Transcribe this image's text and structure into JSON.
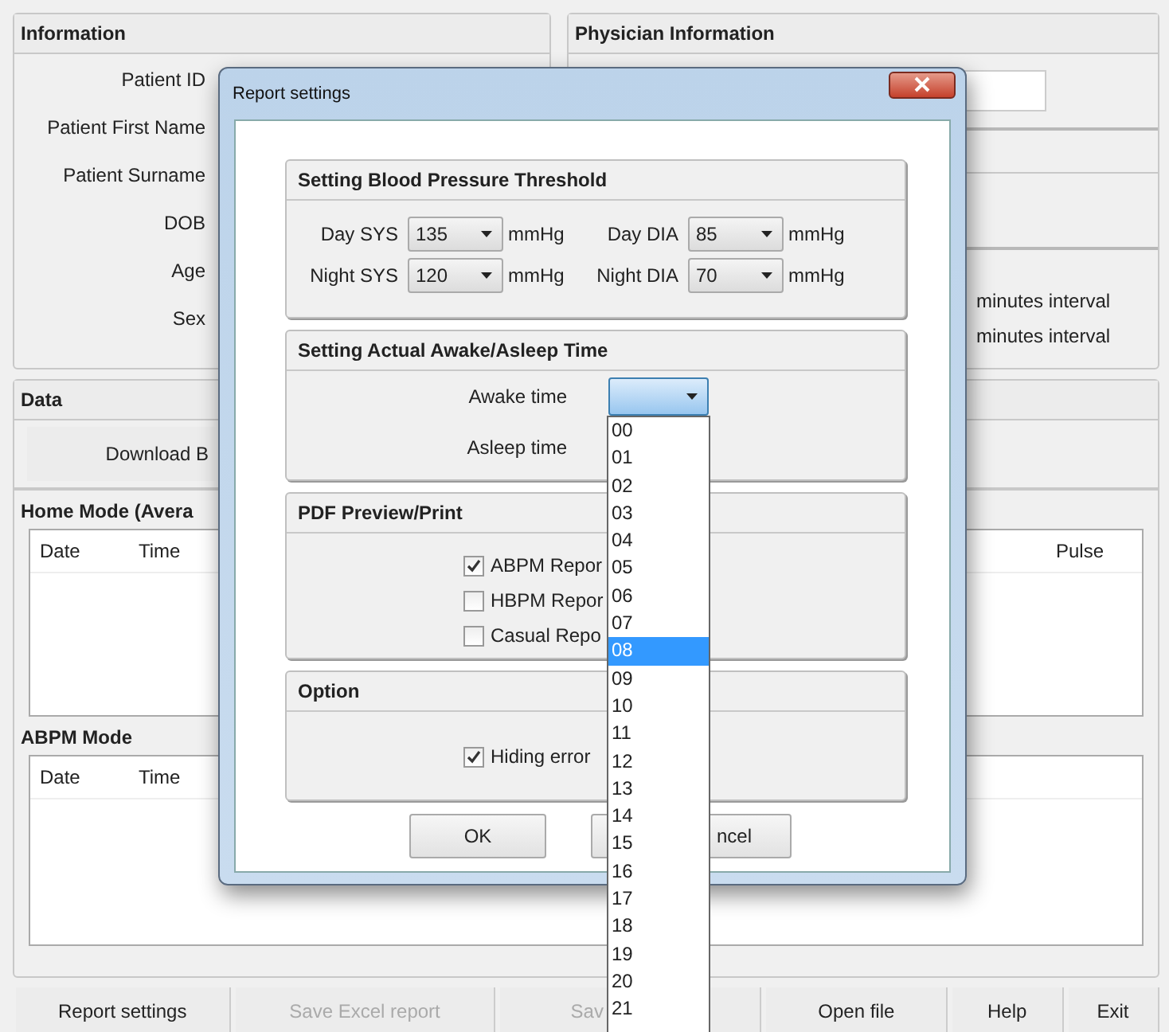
{
  "information": {
    "title": "Information",
    "fields": [
      "Patient ID",
      "Patient First Name",
      "Patient Surname",
      "DOB",
      "Age",
      "Sex"
    ]
  },
  "physician": {
    "title": "Physician Information",
    "intervals": [
      "minutes interval",
      "minutes interval"
    ]
  },
  "data": {
    "title": "Data",
    "download_button": "Download B",
    "home_mode": {
      "title": "Home Mode (Avera",
      "columns": [
        "Date",
        "Time"
      ],
      "right_column": "Pulse"
    },
    "abpm_mode": {
      "title": "ABPM Mode",
      "columns": [
        "Date",
        "Time"
      ]
    }
  },
  "bottom_buttons": [
    {
      "label": "Report settings",
      "disabled": false
    },
    {
      "label": "Save Excel report",
      "disabled": true
    },
    {
      "label": "Sav",
      "disabled": true
    },
    {
      "label": "Open file",
      "disabled": false
    },
    {
      "label": "Help",
      "disabled": false
    },
    {
      "label": "Exit",
      "disabled": false
    }
  ],
  "dialog": {
    "title": "Report settings",
    "threshold": {
      "title": "Setting Blood Pressure Threshold",
      "rows": [
        {
          "label": "Day SYS",
          "value": "135",
          "unit": "mmHg"
        },
        {
          "label": "Day DIA",
          "value": "85",
          "unit": "mmHg"
        },
        {
          "label": "Night SYS",
          "value": "120",
          "unit": "mmHg"
        },
        {
          "label": "Night DIA",
          "value": "70",
          "unit": "mmHg"
        }
      ]
    },
    "time": {
      "title": "Setting Actual Awake/Asleep Time",
      "awake_label": "Awake time",
      "asleep_label": "Asleep time"
    },
    "pdf": {
      "title": "PDF Preview/Print",
      "options": [
        {
          "label": "ABPM Repor",
          "checked": true
        },
        {
          "label": "HBPM Repor",
          "checked": false
        },
        {
          "label": "Casual Repo",
          "checked": false
        }
      ]
    },
    "option": {
      "title": "Option",
      "options": [
        {
          "label": "Hiding error",
          "checked": true
        }
      ]
    },
    "buttons": [
      "OK",
      "ncel"
    ]
  },
  "dropdown": {
    "items": [
      {
        "label": "00",
        "selected": false
      },
      {
        "label": "01",
        "selected": false
      },
      {
        "label": "02",
        "selected": false
      },
      {
        "label": "03",
        "selected": false
      },
      {
        "label": "04",
        "selected": false
      },
      {
        "label": "05",
        "selected": false
      },
      {
        "label": "06",
        "selected": false
      },
      {
        "label": "07",
        "selected": false
      },
      {
        "label": "08",
        "selected": true
      },
      {
        "label": "09",
        "selected": false
      },
      {
        "label": "10",
        "selected": false
      },
      {
        "label": "11",
        "selected": false
      },
      {
        "label": "12",
        "selected": false
      },
      {
        "label": "13",
        "selected": false
      },
      {
        "label": "14",
        "selected": false
      },
      {
        "label": "15",
        "selected": false
      },
      {
        "label": "16",
        "selected": false
      },
      {
        "label": "17",
        "selected": false
      },
      {
        "label": "18",
        "selected": false
      },
      {
        "label": "19",
        "selected": false
      },
      {
        "label": "20",
        "selected": false
      },
      {
        "label": "21",
        "selected": false
      }
    ]
  }
}
